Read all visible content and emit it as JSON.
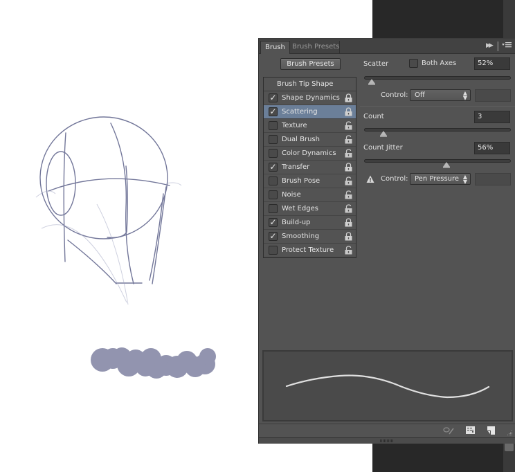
{
  "panel": {
    "tabs": [
      {
        "label": "Brush",
        "active": true
      },
      {
        "label": "Brush Presets",
        "active": false
      }
    ],
    "brush_presets_button": "Brush Presets",
    "options": {
      "header": "Brush Tip Shape",
      "items": [
        {
          "label": "Shape Dynamics",
          "checked": true,
          "selected": false,
          "locked": true
        },
        {
          "label": "Scattering",
          "checked": true,
          "selected": true,
          "locked": true
        },
        {
          "label": "Texture",
          "checked": false,
          "selected": false,
          "locked": false
        },
        {
          "label": "Dual Brush",
          "checked": false,
          "selected": false,
          "locked": false
        },
        {
          "label": "Color Dynamics",
          "checked": false,
          "selected": false,
          "locked": false
        },
        {
          "label": "Transfer",
          "checked": true,
          "selected": false,
          "locked": true
        },
        {
          "label": "Brush Pose",
          "checked": false,
          "selected": false,
          "locked": false
        },
        {
          "label": "Noise",
          "checked": false,
          "selected": false,
          "locked": false
        },
        {
          "label": "Wet Edges",
          "checked": false,
          "selected": false,
          "locked": false
        },
        {
          "label": "Build-up",
          "checked": true,
          "selected": false,
          "locked": true
        },
        {
          "label": "Smoothing",
          "checked": true,
          "selected": false,
          "locked": true
        },
        {
          "label": "Protect Texture",
          "checked": false,
          "selected": false,
          "locked": false
        }
      ]
    },
    "scattering": {
      "scatter_label": "Scatter",
      "both_axes_label": "Both Axes",
      "both_axes_checked": false,
      "scatter_value": "52%",
      "scatter_fraction": 0.05,
      "control1_label": "Control:",
      "control1_value": "Off",
      "count_label": "Count",
      "count_value": "3",
      "count_fraction": 0.13,
      "count_jitter_label": "Count Jitter",
      "count_jitter_value": "56%",
      "count_jitter_fraction": 0.56,
      "control2_label": "Control:",
      "control2_value": "Pen Pressure",
      "warning_icon": "warning-icon"
    },
    "icons": {
      "collapse": "double-arrow-right-icon",
      "menu": "panel-menu-icon",
      "toggle_proof": "eye-brush-icon",
      "grid": "brush-grid-icon",
      "new_preset": "new-preset-icon"
    }
  },
  "colors": {
    "panel_bg": "#535353",
    "selected_row": "#6b7f99",
    "sketch_stroke": "#5a5f88",
    "brush_blob": "#6e7195"
  }
}
